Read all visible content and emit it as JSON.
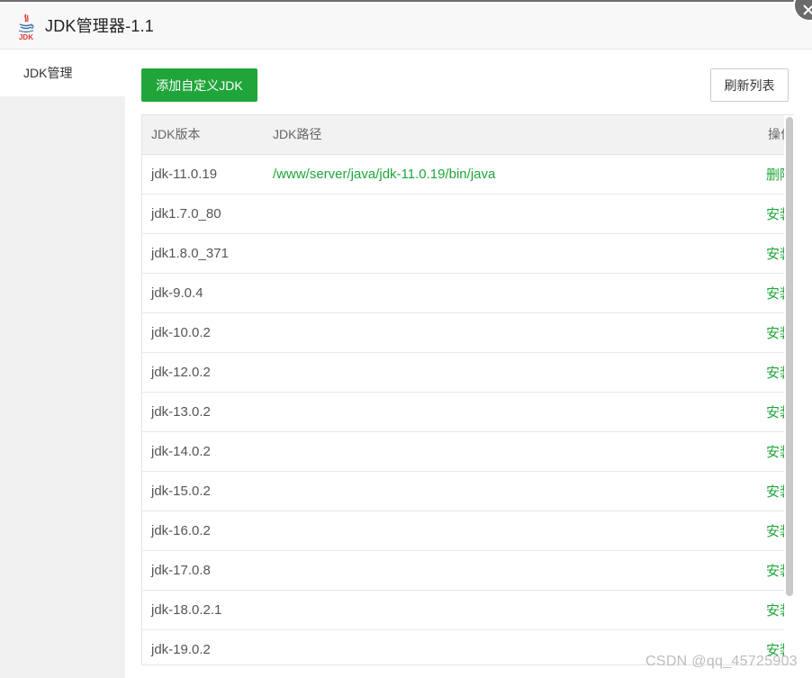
{
  "window": {
    "title": "JDK管理器-1.1",
    "icon": "java-coffee-cup-icon",
    "icon_label": "JDK"
  },
  "sidebar": {
    "items": [
      {
        "label": "JDK管理"
      }
    ]
  },
  "toolbar": {
    "add_label": "添加自定义JDK",
    "refresh_label": "刷新列表"
  },
  "table": {
    "headers": [
      "JDK版本",
      "JDK路径",
      "操作"
    ],
    "rows": [
      {
        "version": "jdk-11.0.19",
        "path": "/www/server/java/jdk-11.0.19/bin/java",
        "action": "删除"
      },
      {
        "version": "jdk1.7.0_80",
        "path": "",
        "action": "安装"
      },
      {
        "version": "jdk1.8.0_371",
        "path": "",
        "action": "安装"
      },
      {
        "version": "jdk-9.0.4",
        "path": "",
        "action": "安装"
      },
      {
        "version": "jdk-10.0.2",
        "path": "",
        "action": "安装"
      },
      {
        "version": "jdk-12.0.2",
        "path": "",
        "action": "安装"
      },
      {
        "version": "jdk-13.0.2",
        "path": "",
        "action": "安装"
      },
      {
        "version": "jdk-14.0.2",
        "path": "",
        "action": "安装"
      },
      {
        "version": "jdk-15.0.2",
        "path": "",
        "action": "安装"
      },
      {
        "version": "jdk-16.0.2",
        "path": "",
        "action": "安装"
      },
      {
        "version": "jdk-17.0.8",
        "path": "",
        "action": "安装"
      },
      {
        "version": "jdk-18.0.2.1",
        "path": "",
        "action": "安装"
      },
      {
        "version": "jdk-19.0.2",
        "path": "",
        "action": "安装"
      }
    ]
  },
  "watermark": "CSDN @qq_45725903",
  "colors": {
    "accent": "#20a53a",
    "titlebar_bg": "#f8f8f8",
    "sidebar_bg": "#f0f0f0",
    "header_bg": "#f2f2f2"
  }
}
